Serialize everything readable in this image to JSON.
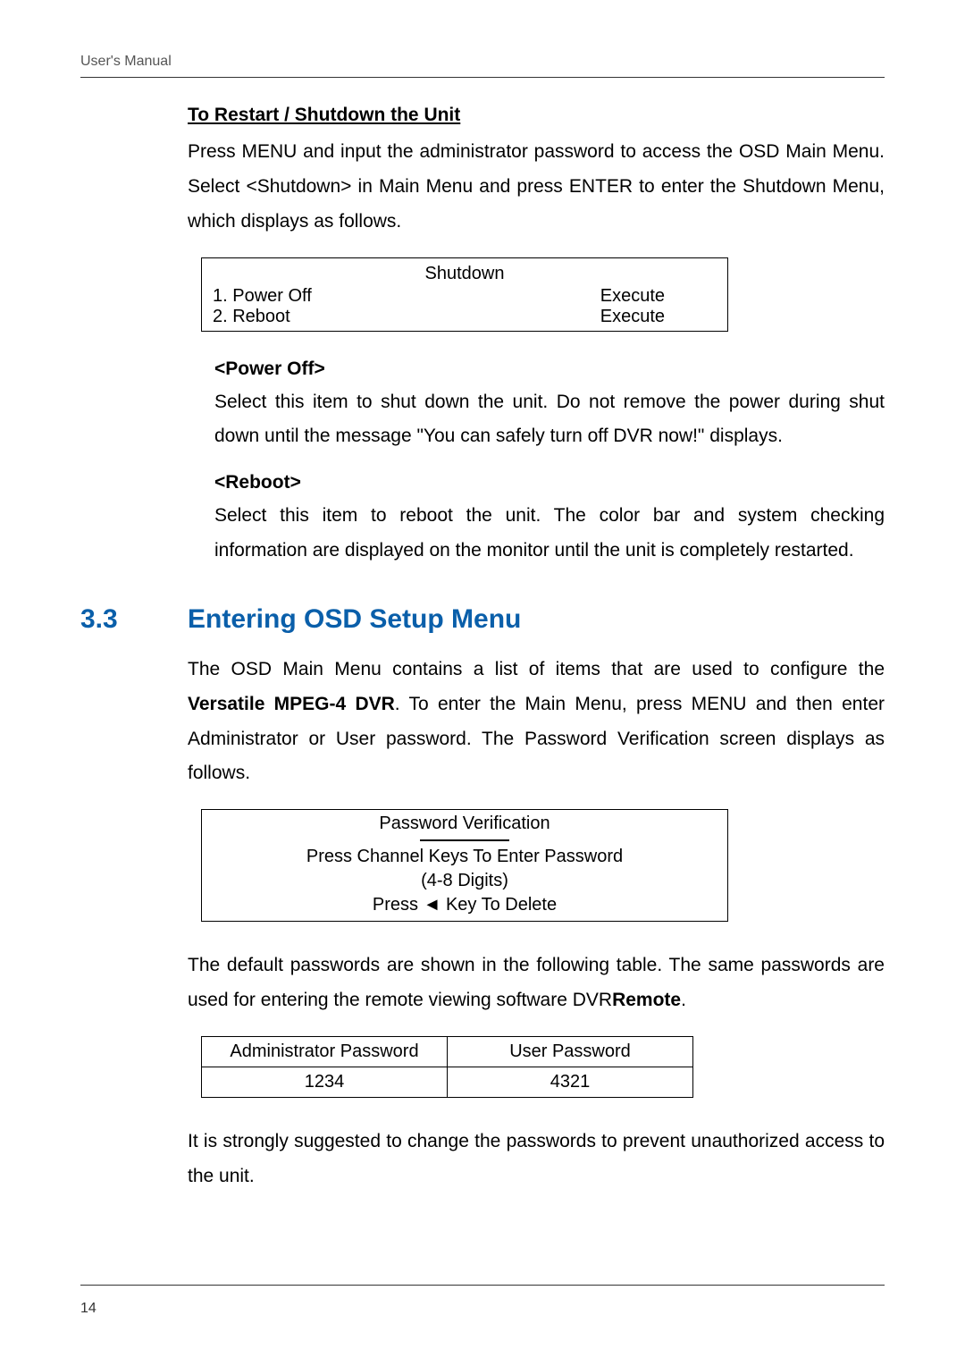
{
  "header": {
    "label": "User's Manual"
  },
  "restart_section": {
    "heading": "To Restart / Shutdown the Unit",
    "paragraph": "Press MENU and input the administrator password to access the OSD Main Menu. Select <Shutdown> in Main Menu and press ENTER to enter the Shutdown Menu, which displays as follows."
  },
  "shutdown_box": {
    "title": "Shutdown",
    "row1_left": "1. Power Off",
    "row1_right": "Execute",
    "row2_left": "2. Reboot",
    "row2_right": "Execute"
  },
  "poweroff": {
    "heading": "<Power Off>",
    "text": "Select this item to shut down the unit. Do not remove the power during shut down until the message \"You can safely turn off DVR now!\" displays."
  },
  "reboot": {
    "heading": "<Reboot>",
    "text": "Select this item to reboot the unit. The color bar and system checking information are displayed on the monitor until the unit is completely restarted."
  },
  "osd_section": {
    "number": "3.3",
    "title": "Entering OSD Setup Menu",
    "para1_pre": "The OSD Main Menu contains a list of items that are used to configure the ",
    "para1_bold": "Versatile MPEG-4 DVR",
    "para1_post": ". To enter the Main Menu, press MENU and then enter Administrator or User password. The Password Verification screen displays as follows."
  },
  "pw_verif": {
    "title": "Password Verification",
    "line1": "Press Channel Keys To Enter Password",
    "line2": "(4-8 Digits)",
    "line3": "Press ◄ Key To Delete"
  },
  "default_pw_para_pre": "The default passwords are shown in the following table. The same passwords are used for entering the remote viewing software DVR",
  "default_pw_para_bold": "Remote",
  "default_pw_para_post": ".",
  "pw_table": {
    "header1": "Administrator Password",
    "header2": "User Password",
    "cell1": "1234",
    "cell2": "4321"
  },
  "closing_para": "It is strongly suggested to change the passwords to prevent unauthorized access to the unit.",
  "page_number": "14"
}
